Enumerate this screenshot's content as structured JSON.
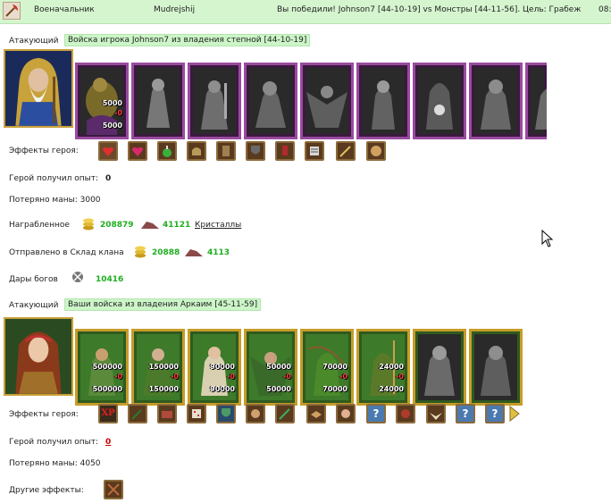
{
  "header": {
    "role": "Военачальник",
    "player": "Mudrejshij",
    "result": "Вы победили! Johnson7 [44-10-19] vs Монстры [44-11-56]. Цель: Грабеж",
    "time": "08:"
  },
  "army1": {
    "label": "Атакующий",
    "title": "Войска игрока Johnson7 из владения степной [44-10-19]",
    "units": [
      {
        "count": "5000",
        "remaining": "5000",
        "sub": "-0"
      },
      {
        "count": "",
        "remaining": ""
      },
      {
        "count": "",
        "remaining": ""
      },
      {
        "count": "",
        "remaining": ""
      },
      {
        "count": "",
        "remaining": ""
      },
      {
        "count": "",
        "remaining": ""
      },
      {
        "count": "",
        "remaining": ""
      },
      {
        "count": "",
        "remaining": ""
      }
    ],
    "effects_label": "Эффекты героя:",
    "effects_icons": [
      "heart-icon",
      "heart-plus-icon",
      "potion-icon",
      "helmet-icon",
      "armor-icon",
      "shield-icon",
      "banner-icon",
      "scroll-icon",
      "sword-icon",
      "orb-icon"
    ],
    "exp_label": "Герой получил опыт:",
    "exp_value": "0",
    "mana_label": "Потеряно маны: 3000",
    "loot_label": "Награбленное",
    "loot_gold": "208879",
    "loot_ore": "41121",
    "loot_link": "Кристаллы",
    "clan_label": "Отправлено в Склад клана",
    "clan_gold": "20888",
    "clan_ore": "4113",
    "gifts_label": "Дары богов",
    "gifts_value": "10416"
  },
  "army2": {
    "label": "Атакующий",
    "title": "Ваши войска из владения Аркаим [45-11-59]",
    "units": [
      {
        "count": "500000",
        "sub": "-0",
        "remaining": "500000"
      },
      {
        "count": "150000",
        "sub": "-0",
        "remaining": "150000"
      },
      {
        "count": "90000",
        "sub": "-0",
        "remaining": "90000"
      },
      {
        "count": "50000",
        "sub": "-0",
        "remaining": "50000"
      },
      {
        "count": "70000",
        "sub": "-0",
        "remaining": "70000"
      },
      {
        "count": "24000",
        "sub": "-0",
        "remaining": "24000"
      },
      {
        "count": "",
        "sub": "",
        "remaining": ""
      },
      {
        "count": "",
        "sub": "",
        "remaining": ""
      }
    ],
    "effects_label": "Эффекты героя:",
    "effects_icons": [
      "xp-icon",
      "dagger-x2-icon",
      "chest-icon",
      "dice-icon",
      "shield-icon",
      "hands-icon",
      "sword-icon",
      "handshake-icon",
      "hand-icon",
      "question-icon",
      "demon-icon",
      "angel-icon",
      "question-icon",
      "question-icon",
      "arrow-right-icon"
    ],
    "xp_text": "XP",
    "q_text": "?",
    "exp_label": "Герой получил опыт:",
    "exp_value": "0",
    "mana_label": "Потеряно маны: 4050",
    "other_label": "Другие эффекты:"
  },
  "colors": {
    "accent_green": "#1fae1f",
    "header_bg": "#d5f5cf",
    "loss_red": "#cc0000"
  }
}
